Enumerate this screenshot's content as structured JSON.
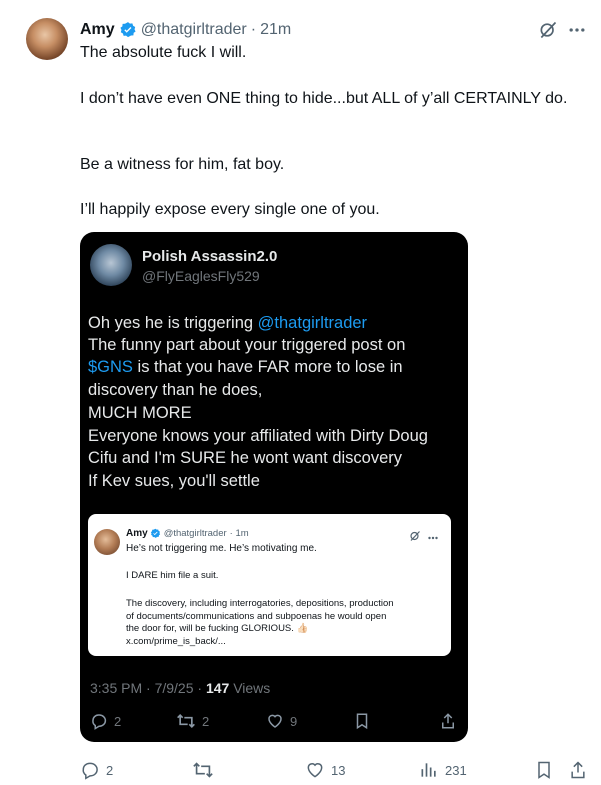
{
  "post": {
    "author_name": "Amy",
    "handle": "@thatgirltrader",
    "sep": "·",
    "time": "21m",
    "text": [
      "The absolute fuck I will.",
      "I don’t have even ONE thing to hide...but ALL of y’all CERTAINLY do.",
      "Be a witness for him, fat boy.",
      "I’ll happily expose every single one of you."
    ],
    "actions": {
      "replies": "2",
      "reposts": "",
      "likes": "13",
      "views": "231"
    }
  },
  "embedded": {
    "author_name": "Polish Assassin2.0",
    "handle": "@FlyEaglesFly529",
    "lines": [
      {
        "pre": "Oh yes he is triggering ",
        "link": "@thatgirltrader",
        "post": ""
      },
      {
        "pre": "The funny part about your triggered post on",
        "link": "",
        "post": ""
      },
      {
        "pre": "",
        "link": "$GNS",
        "post": " is that you have FAR more to lose in"
      },
      {
        "pre": "discovery than he does,",
        "link": "",
        "post": ""
      },
      {
        "pre": "MUCH MORE",
        "link": "",
        "post": ""
      },
      {
        "pre": "Everyone knows your affiliated with Dirty Doug",
        "link": "",
        "post": ""
      },
      {
        "pre": "Cifu and I'm SURE he wont want discovery",
        "link": "",
        "post": ""
      },
      {
        "pre": "If Kev sues, you'll settle",
        "link": "",
        "post": ""
      }
    ],
    "meta_time": "3:35 PM · 7/9/25 · ",
    "meta_views_count": "147",
    "meta_views_label": " Views",
    "actions": {
      "replies": "2",
      "reposts": "2",
      "likes": "9"
    },
    "quote": {
      "author_name": "Amy",
      "handle": "@thatgirltrader",
      "time": "· 1m",
      "p1": "He’s not triggering me.  He’s motivating me.",
      "p2": "I DARE him file a suit.",
      "p3": [
        "The discovery, including interrogatories, depositions, production",
        "of documents/communications and subpoenas he would open",
        "the door for, will be fucking GLORIOUS. 👍🏻"
      ],
      "link": "x.com/prime_is_back/..."
    }
  },
  "colors": {
    "verified": "#1d9bf0",
    "link": "#1d9bf0",
    "muted": "#536471",
    "card_bg": "#000000"
  },
  "icons": [
    "verified-badge-icon",
    "grok-icon",
    "more-icon",
    "reply-icon",
    "repost-icon",
    "like-icon",
    "bookmark-icon",
    "share-icon",
    "views-icon"
  ]
}
